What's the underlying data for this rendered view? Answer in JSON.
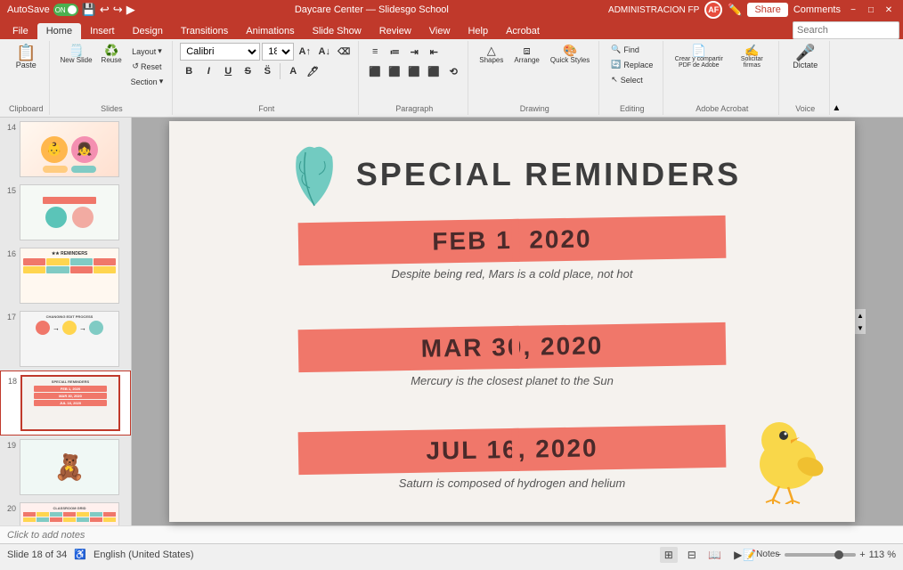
{
  "titlebar": {
    "autosave_label": "AutoSave",
    "autosave_state": "ON",
    "title": "Daycare Center — Slidesgo School",
    "user_initials": "AF",
    "admin_label": "ADMINISTRACION FP",
    "share_label": "Share",
    "comments_label": "Comments",
    "minimize_label": "−",
    "restore_label": "□",
    "close_label": "✕"
  },
  "ribbon_tabs": [
    "File",
    "Home",
    "Insert",
    "Design",
    "Transitions",
    "Animations",
    "Slide Show",
    "Review",
    "View",
    "Help",
    "Acrobat"
  ],
  "ribbon_active_tab": "Home",
  "ribbon": {
    "clipboard_label": "Clipboard",
    "slides_label": "Slides",
    "font_label": "Font",
    "paragraph_label": "Paragraph",
    "drawing_label": "Drawing",
    "editing_label": "Editing",
    "adobe_label": "Adobe Acrobat",
    "voice_label": "Voice",
    "paste_label": "Paste",
    "new_slide_label": "New Slide",
    "layout_label": "Layout",
    "reset_label": "Reset",
    "section_label": "Section",
    "shapes_label": "Shapes",
    "arrange_label": "Arrange",
    "quick_label": "Quick Styles",
    "find_label": "Find",
    "replace_label": "Replace",
    "select_label": "Select",
    "create_pdf_label": "Crear y compartir PDF de Adobe",
    "solicitar_label": "Solicitar firmas",
    "dictate_label": "Dictate"
  },
  "format_bar": {
    "font_name": "Calibri",
    "font_size": "18",
    "bold": "B",
    "italic": "I",
    "underline": "U",
    "strikethrough": "S"
  },
  "search": {
    "placeholder": "Search"
  },
  "slides": [
    {
      "num": "14",
      "type": "photo"
    },
    {
      "num": "15",
      "type": "shapes"
    },
    {
      "num": "16",
      "type": "table"
    },
    {
      "num": "17",
      "type": "process"
    },
    {
      "num": "18",
      "type": "reminders",
      "active": true
    },
    {
      "num": "19",
      "type": "toys"
    },
    {
      "num": "20",
      "type": "calendar"
    }
  ],
  "slide": {
    "title": "SPECIAL REMINDERS",
    "reminders": [
      {
        "date": "FEB 1, 2020",
        "text": "Despite being red, Mars is a cold place, not hot"
      },
      {
        "date": "MAR 30, 2020",
        "text": "Mercury is the closest planet to the Sun"
      },
      {
        "date": "JUL 16, 2020",
        "text": "Saturn is composed of hydrogen and helium"
      }
    ]
  },
  "statusbar": {
    "slide_position": "Slide 18 of 34",
    "language": "English (United States)",
    "notes_label": "Notes",
    "zoom_level": "113 %",
    "click_to_add": "Click to add notes"
  }
}
